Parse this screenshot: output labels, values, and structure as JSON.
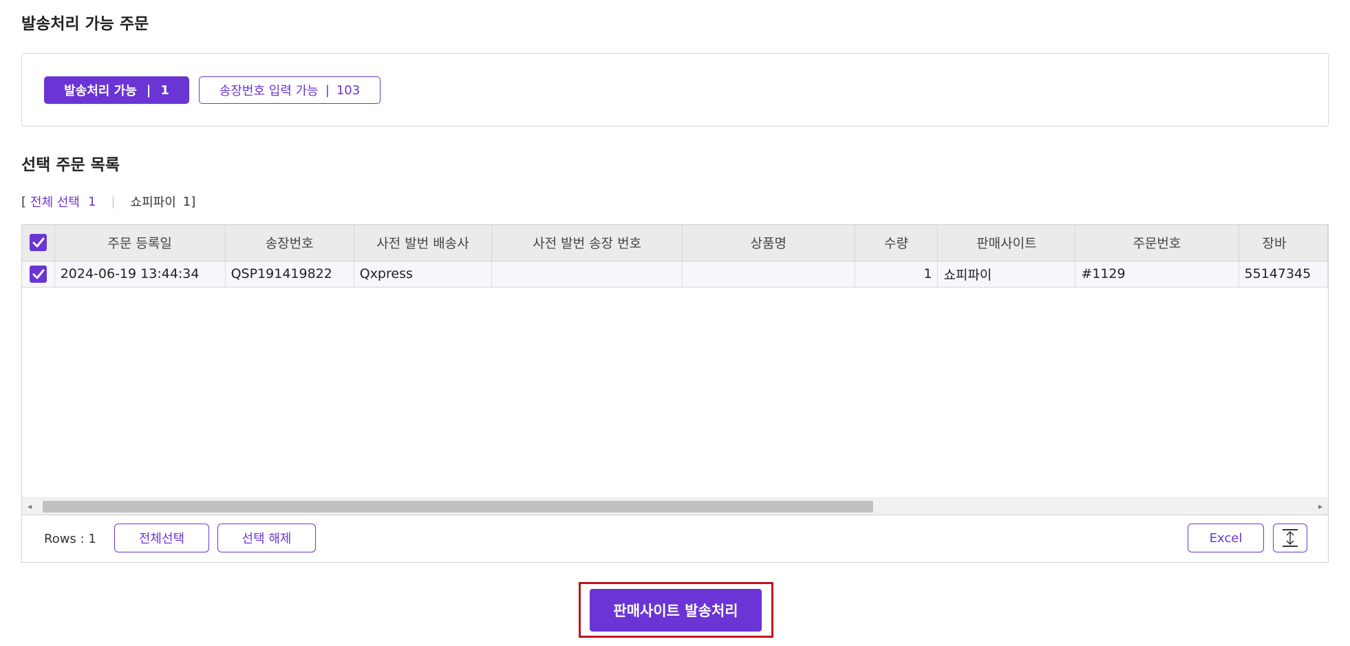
{
  "sections": {
    "available_title": "발송처리 가능 주문",
    "list_title": "선택 주문 목록"
  },
  "status_chips": {
    "active": {
      "label": "발송처리 가능",
      "count": "1"
    },
    "outline": {
      "label": "송장번호 입력 가능",
      "count": "103"
    },
    "separator": "|"
  },
  "filter": {
    "open_bracket": "[",
    "all_label": "전체 선택",
    "all_count": "1",
    "divider": "|",
    "site_label": "쇼피파이",
    "site_count": "1",
    "close_bracket": "]"
  },
  "table": {
    "columns": [
      "주문 등록일",
      "송장번호",
      "사전 발번 배송사",
      "사전 발번 송장 번호",
      "상품명",
      "수량",
      "판매사이트",
      "주문번호",
      "장바"
    ],
    "rows": [
      {
        "checked": true,
        "order_date": "2024-06-19 13:44:34",
        "invoice_no": "QSP191419822",
        "pre_carrier": "Qxpress",
        "pre_invoice_no": "",
        "product_name": "",
        "quantity": "1",
        "site": "쇼피파이",
        "order_no": "#1129",
        "cart": "55147345"
      }
    ],
    "header_checked": true,
    "scroll_left_arrow": "◂",
    "scroll_right_arrow": "▸"
  },
  "footer": {
    "rows_label": "Rows : 1",
    "select_all_button": "전체선택",
    "deselect_button": "선택 해제",
    "excel_button": "Excel",
    "resize_icon": "vertical-resize-icon"
  },
  "main_action": {
    "label": "판매사이트 발송처리"
  },
  "colors": {
    "accent": "#6a35d4",
    "highlight_frame": "#c0141d"
  }
}
